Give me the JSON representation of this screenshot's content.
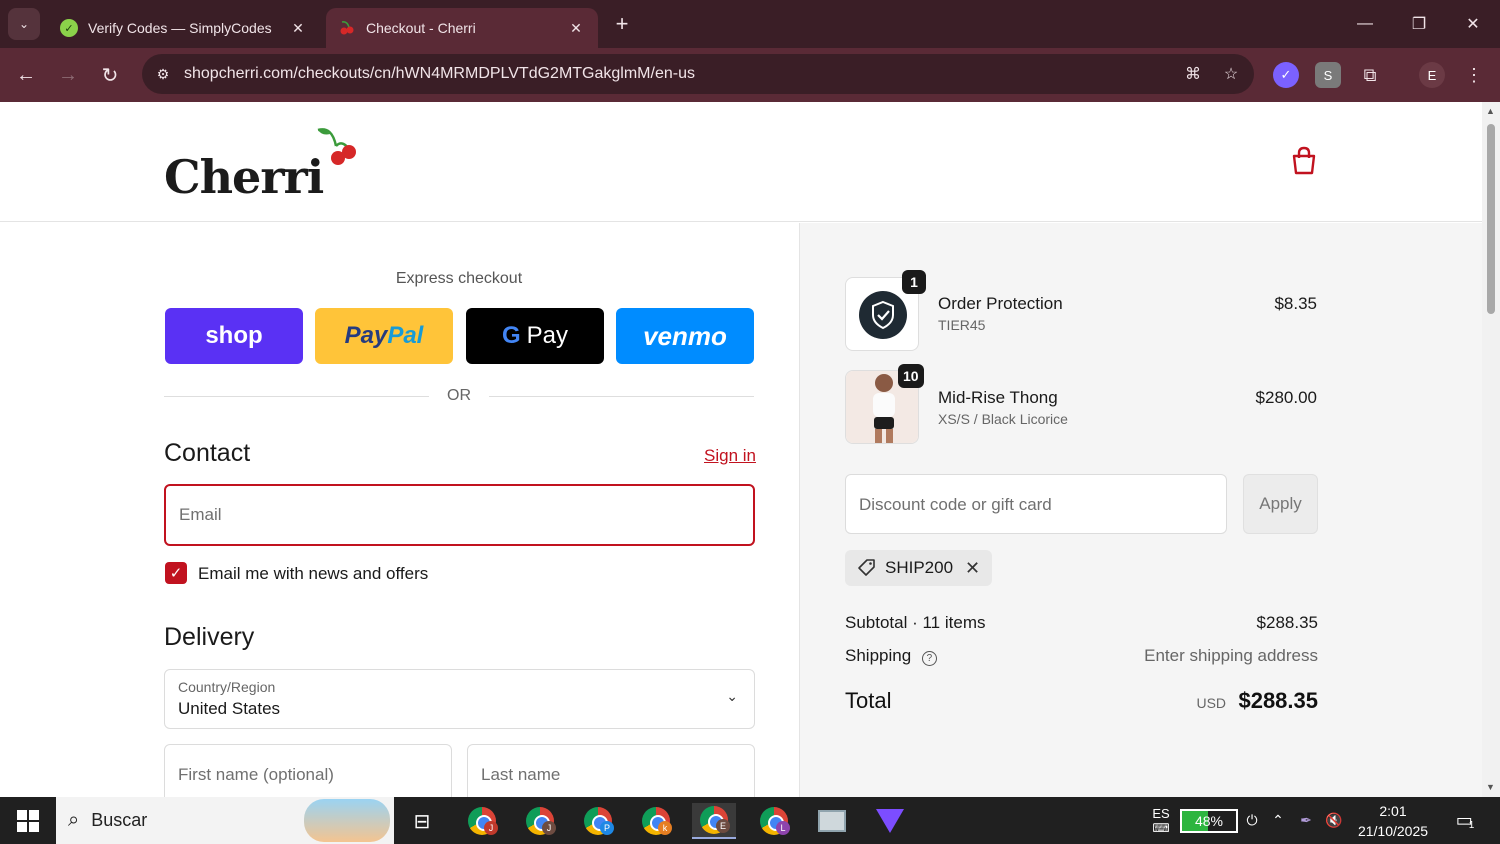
{
  "browser": {
    "tabs": [
      {
        "title": "Verify Codes — SimplyCodes",
        "favicon": "simplycodes-icon"
      },
      {
        "title": "Checkout - Cherri",
        "favicon": "cherry-icon"
      }
    ],
    "new_tab": "+",
    "url": "shopcherri.com/checkouts/cn/hWN4MRMDPLVTdG2MTGakglmM/en-us",
    "profile_initial": "E",
    "extension_label": "S"
  },
  "store": {
    "logo": "Cherri",
    "accent_color": "#c1121f"
  },
  "express": {
    "label": "Express checkout",
    "buttons": {
      "shop": "shop",
      "paypal_pay": "Pay",
      "paypal_pal": "Pal",
      "gpay": "Pay",
      "venmo": "venmo"
    },
    "or_label": "OR"
  },
  "contact": {
    "heading": "Contact",
    "sign_in": "Sign in",
    "email_placeholder": "Email",
    "newsletter_label": "Email me with news and offers",
    "newsletter_checked": true
  },
  "delivery": {
    "heading": "Delivery",
    "country_label": "Country/Region",
    "country_value": "United States",
    "first_name_placeholder": "First name (optional)",
    "last_name_placeholder": "Last name"
  },
  "summary": {
    "items": [
      {
        "name": "Order Protection",
        "variant": "TIER45",
        "quantity": "1",
        "price": "$8.35"
      },
      {
        "name": "Mid-Rise Thong",
        "variant": "XS/S / Black Licorice",
        "quantity": "10",
        "price": "$280.00"
      }
    ],
    "discount_placeholder": "Discount code or gift card",
    "apply_label": "Apply",
    "applied_code": "SHIP200",
    "subtotal_label": "Subtotal · 11 items",
    "subtotal_value": "$288.35",
    "shipping_label": "Shipping",
    "shipping_value": "Enter shipping address",
    "total_label": "Total",
    "total_currency": "USD",
    "total_value": "$288.35"
  },
  "taskbar": {
    "search_placeholder": "Buscar",
    "apps": [
      {
        "badge": "J",
        "color": "#c0392b"
      },
      {
        "badge": "J",
        "color": "#6d4c41"
      },
      {
        "badge": "P",
        "color": "#1e88e5"
      },
      {
        "badge": "k",
        "color": "#e67e22"
      },
      {
        "badge": "E",
        "color": "#6d4c41"
      },
      {
        "badge": "L",
        "color": "#8e44ad"
      }
    ],
    "language": "ES",
    "battery_percent": 48,
    "battery_label": "48%",
    "time": "2:01",
    "date": "21/10/2025",
    "notifications": "1"
  }
}
